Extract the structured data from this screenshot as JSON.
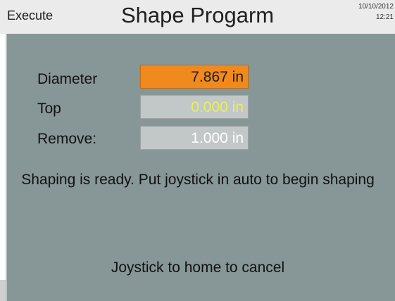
{
  "header": {
    "mode": "Execute",
    "title": "Shape Progarm",
    "date": "10/10/2012",
    "time": "12:21"
  },
  "fields": [
    {
      "label": "Diameter",
      "value": "7.867 in"
    },
    {
      "label": "Top",
      "value": "0.000 in"
    },
    {
      "label": "Remove:",
      "value": "1.000 in"
    }
  ],
  "status_message": "Shaping is ready. Put joystick in auto to begin shaping",
  "cancel_message": "Joystick to home to cancel",
  "colors": {
    "panel": "#879696",
    "active_field": "#f18a1c",
    "readonly_field": "#c2c7c7",
    "highlight_text": "#e8f05a"
  }
}
